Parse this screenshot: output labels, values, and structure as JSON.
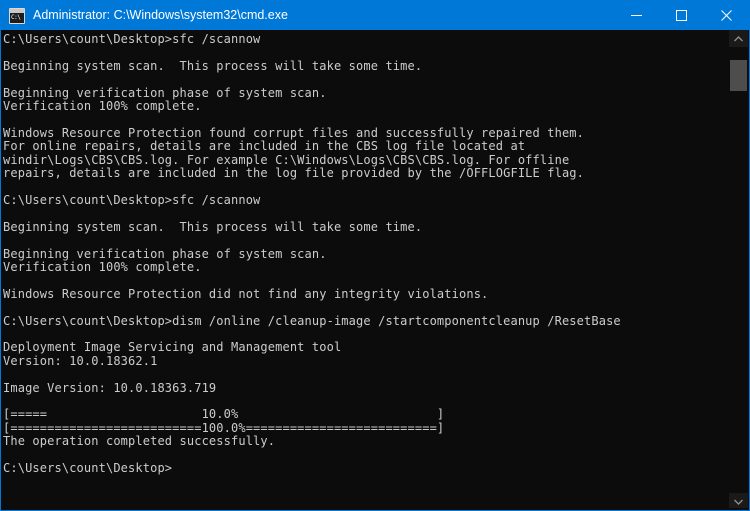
{
  "window": {
    "title": "Administrator: C:\\Windows\\system32\\cmd.exe",
    "icon_prompt": "C:\\",
    "accent_color": "#0078d7",
    "background_color": "#0c0c0c",
    "text_color": "#cccccc",
    "controls": {
      "minimize_label": "Minimize",
      "maximize_label": "Maximize",
      "close_label": "Close"
    }
  },
  "scrollbar": {
    "up_arrow_label": "Scroll up",
    "down_arrow_label": "Scroll down",
    "thumb_label": "Scroll thumb"
  },
  "console": {
    "prompt": "C:\\Users\\count\\Desktop>",
    "commands": [
      "sfc /scannow",
      "sfc /scannow",
      "dism /online /cleanup-image /startcomponentcleanup /ResetBase"
    ],
    "progress": [
      {
        "percent": "10.0%",
        "filled": 5,
        "total": 48
      },
      {
        "percent": "100.0%",
        "filled": 48,
        "total": 48
      }
    ],
    "versions": {
      "tool": "Deployment Image Servicing and Management tool",
      "tool_version": "Version: 10.0.18362.1",
      "image_version": "Image Version: 10.0.18363.719"
    },
    "lines": [
      "C:\\Users\\count\\Desktop>sfc /scannow",
      "",
      "Beginning system scan.  This process will take some time.",
      "",
      "Beginning verification phase of system scan.",
      "Verification 100% complete.",
      "",
      "Windows Resource Protection found corrupt files and successfully repaired them.",
      "For online repairs, details are included in the CBS log file located at",
      "windir\\Logs\\CBS\\CBS.log. For example C:\\Windows\\Logs\\CBS\\CBS.log. For offline",
      "repairs, details are included in the log file provided by the /OFFLOGFILE flag.",
      "",
      "C:\\Users\\count\\Desktop>sfc /scannow",
      "",
      "Beginning system scan.  This process will take some time.",
      "",
      "Beginning verification phase of system scan.",
      "Verification 100% complete.",
      "",
      "Windows Resource Protection did not find any integrity violations.",
      "",
      "C:\\Users\\count\\Desktop>dism /online /cleanup-image /startcomponentcleanup /ResetBase",
      "",
      "Deployment Image Servicing and Management tool",
      "Version: 10.0.18362.1",
      "",
      "Image Version: 10.0.18363.719",
      "",
      "[=====                     10.0%                           ]",
      "[==========================100.0%==========================]",
      "The operation completed successfully.",
      "",
      "C:\\Users\\count\\Desktop>"
    ]
  }
}
